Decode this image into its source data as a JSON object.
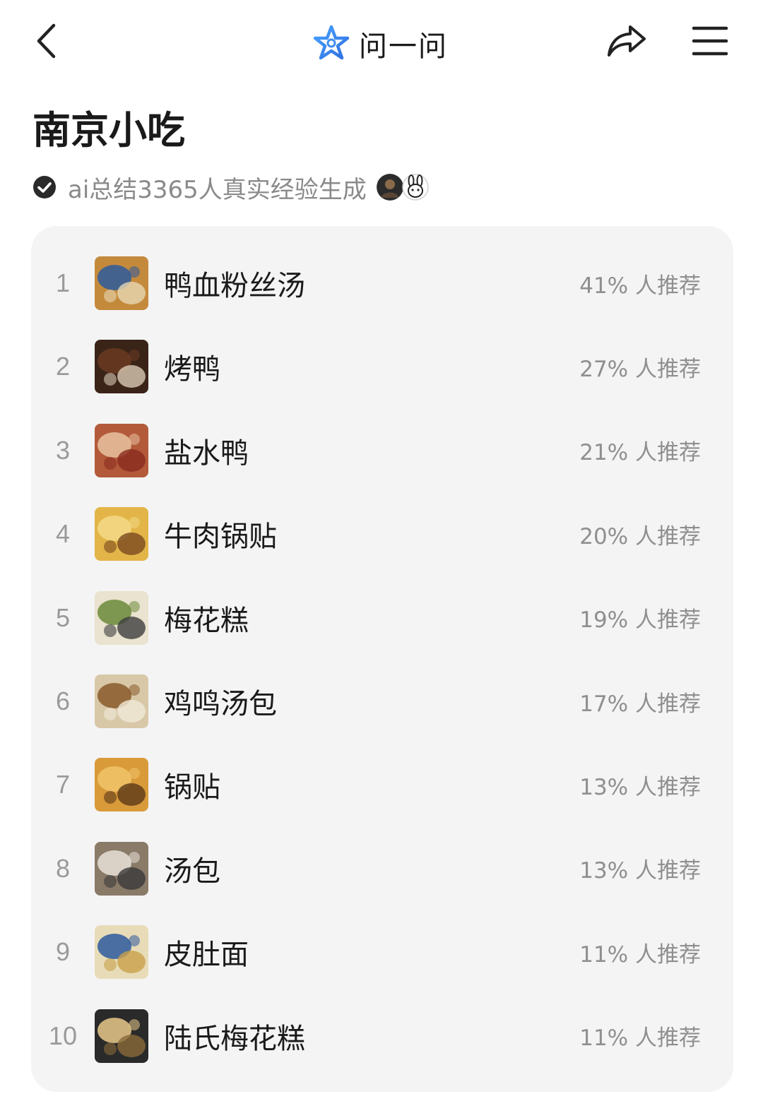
{
  "header": {
    "title": "问一问",
    "icons": {
      "back": "chevron-left-icon",
      "logo": "sparkle-star-icon",
      "share": "share-arrow-icon",
      "menu": "hamburger-menu-icon"
    },
    "accent": "#4a90e2"
  },
  "page": {
    "heading": "南京小吃",
    "subtitle": "ai总结3365人真实经验生成"
  },
  "list": {
    "items": [
      {
        "rank": "1",
        "name": "鸭血粉丝汤",
        "percent": "41% 人推荐",
        "thumb_colors": [
          "#c48a3c",
          "#2e5a9c",
          "#e7d7b3"
        ]
      },
      {
        "rank": "2",
        "name": "烤鸭",
        "percent": "27% 人推荐",
        "thumb_colors": [
          "#3a2418",
          "#6b3a22",
          "#d9c9b4"
        ]
      },
      {
        "rank": "3",
        "name": "盐水鸭",
        "percent": "21% 人推荐",
        "thumb_colors": [
          "#b35a3a",
          "#e8c2a0",
          "#8a2b1f"
        ]
      },
      {
        "rank": "4",
        "name": "牛肉锅贴",
        "percent": "20% 人推荐",
        "thumb_colors": [
          "#e3b548",
          "#f3d987",
          "#7a4a20"
        ]
      },
      {
        "rank": "5",
        "name": "梅花糕",
        "percent": "19% 人推荐",
        "thumb_colors": [
          "#e9e3cf",
          "#6b8a3a",
          "#3d3d3d"
        ]
      },
      {
        "rank": "6",
        "name": "鸡鸣汤包",
        "percent": "17% 人推荐",
        "thumb_colors": [
          "#d8c8a8",
          "#8a5a2a",
          "#f1ead8"
        ]
      },
      {
        "rank": "7",
        "name": "锅贴",
        "percent": "13% 人推荐",
        "thumb_colors": [
          "#d99a3a",
          "#f0c46a",
          "#5a3818"
        ]
      },
      {
        "rank": "8",
        "name": "汤包",
        "percent": "13% 人推荐",
        "thumb_colors": [
          "#8a7a68",
          "#e8e2d8",
          "#3a3a3a"
        ]
      },
      {
        "rank": "9",
        "name": "皮肚面",
        "percent": "11% 人推荐",
        "thumb_colors": [
          "#e8dcb8",
          "#2e5a9c",
          "#c8a04a"
        ]
      },
      {
        "rank": "10",
        "name": "陆氏梅花糕",
        "percent": "11% 人推荐",
        "thumb_colors": [
          "#2a2a2a",
          "#e8c88a",
          "#8a6a3a"
        ]
      }
    ]
  }
}
